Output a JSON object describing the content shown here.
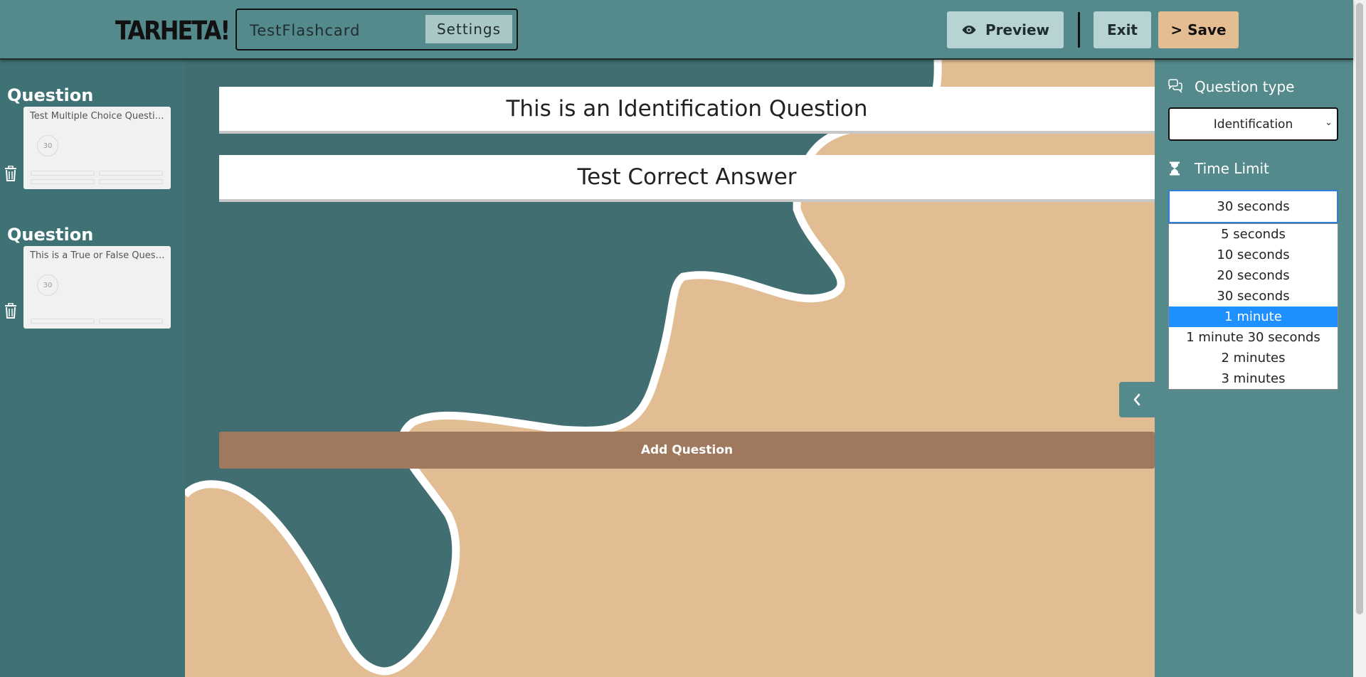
{
  "app": {
    "logo_text": "TARHETA!",
    "deck_title": "TestFlashcard",
    "settings_label": "Settings",
    "preview_label": "Preview",
    "exit_label": "Exit",
    "save_label": "> Save"
  },
  "sidebar": {
    "questions": [
      {
        "heading": "Question",
        "title": "Test Multiple Choice Question",
        "timer": "30"
      },
      {
        "heading": "Question",
        "title": "This is a True or False Question",
        "timer": "30"
      }
    ]
  },
  "editor": {
    "question_text": "This is an Identification Question",
    "answer_text": "Test Correct Answer",
    "add_question_label": "Add Question"
  },
  "panel": {
    "question_type_label": "Question type",
    "question_type_value": "Identification",
    "time_limit_label": "Time Limit",
    "time_limit_value": "30 seconds",
    "time_options": [
      "5 seconds",
      "10 seconds",
      "20 seconds",
      "30 seconds",
      "1 minute",
      "1 minute 30 seconds",
      "2 minutes",
      "3 minutes"
    ],
    "highlighted_option": "1 minute"
  },
  "colors": {
    "topbar": "#548a8b",
    "sidebar": "#3f7274",
    "canvas_sand": "#e2bd93",
    "add_button": "#a0785e",
    "save_button": "#e4bd92",
    "highlight": "#1e90ff"
  },
  "icons": {
    "preview": "eye-icon",
    "delete": "trash-icon",
    "question_type": "chat-bubbles-icon",
    "time_limit": "hourglass-icon",
    "collapse": "chevron-left-icon"
  }
}
